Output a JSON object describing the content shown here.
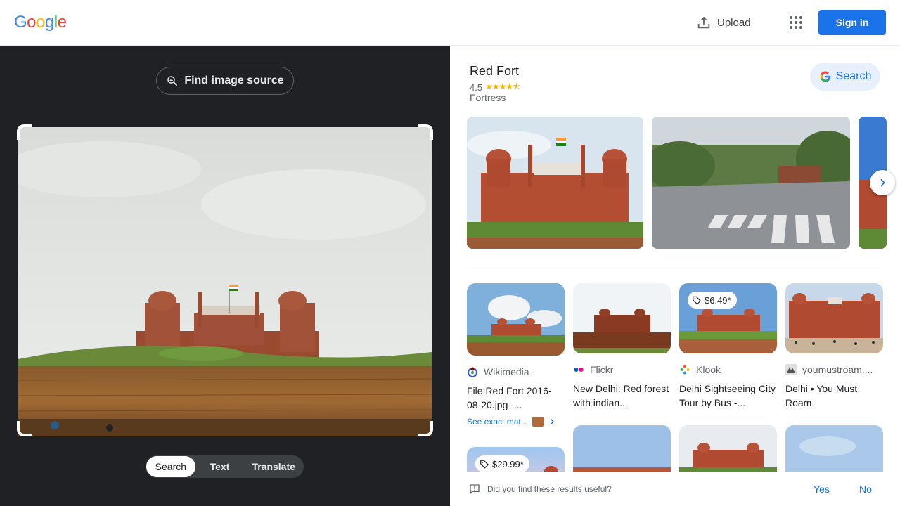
{
  "header": {
    "logo_letters": [
      "G",
      "o",
      "o",
      "g",
      "l",
      "e"
    ],
    "logo_colors": [
      "#4285f4",
      "#ea4335",
      "#fbbc05",
      "#4285f4",
      "#34a853",
      "#ea4335"
    ],
    "upload_label": "Upload",
    "apps_icon": "apps-grid-icon",
    "signin_label": "Sign in"
  },
  "left": {
    "find_source_label": "Find image source",
    "tabs": [
      {
        "label": "Search",
        "active": true
      },
      {
        "label": "Text",
        "active": false
      },
      {
        "label": "Translate",
        "active": false
      }
    ]
  },
  "knowledge": {
    "title": "Red Fort",
    "rating": "4.5",
    "stars": "★★★★⯪",
    "type": "Fortress",
    "search_label": "Search"
  },
  "results": [
    {
      "source": "Wikimedia",
      "title": "File:Red Fort 2016-08-20.jpg -...",
      "exact": "See exact mat...",
      "price": ""
    },
    {
      "source": "Flickr",
      "title": "New Delhi: Red forest with indian...",
      "exact": "",
      "price": ""
    },
    {
      "source": "Klook",
      "title": "Delhi Sightseeing City Tour by Bus -...",
      "exact": "",
      "price": "$6.49*"
    },
    {
      "source": "youmustroam....",
      "title": "Delhi • You Must Roam",
      "exact": "",
      "price": ""
    }
  ],
  "second_row": [
    {
      "price": "$29.99*"
    }
  ],
  "feedback": {
    "question": "Did you find these results useful?",
    "yes": "Yes",
    "no": "No"
  },
  "colors": {
    "accent": "#1a73e8",
    "dark_panel": "#202124"
  }
}
